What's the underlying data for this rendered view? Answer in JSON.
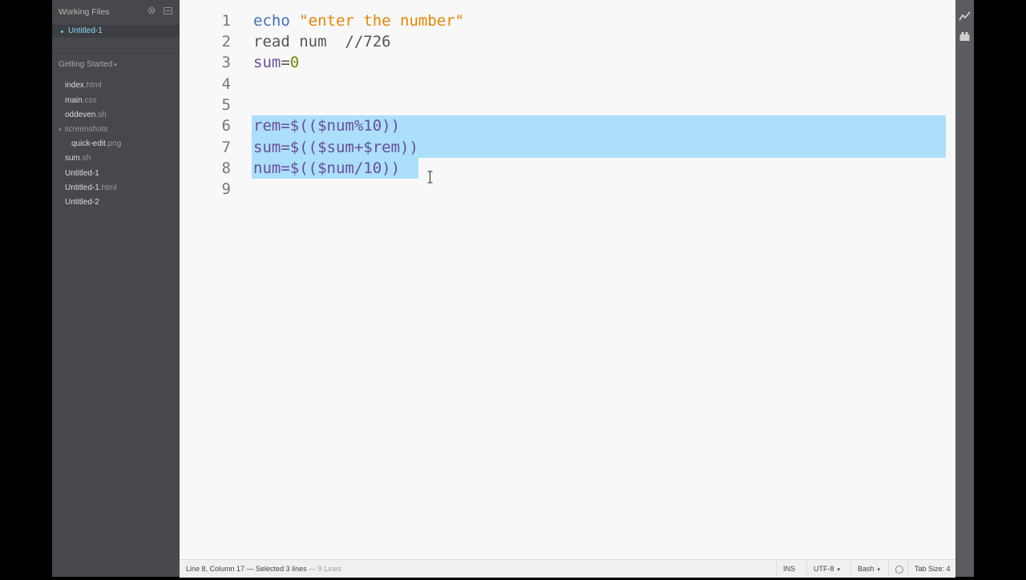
{
  "sidebar": {
    "working_files_label": "Working Files",
    "active_file": "Untitled-1",
    "project_label": "Getting Started",
    "tree": [
      {
        "name": "index",
        "ext": ".html"
      },
      {
        "name": "main",
        "ext": ".css"
      },
      {
        "name": "oddeven",
        "ext": ".sh"
      },
      {
        "name": "screenshots",
        "ext": "",
        "folder": true
      },
      {
        "name": "quick-edit",
        "ext": ".png"
      },
      {
        "name": "sum",
        "ext": ".sh"
      },
      {
        "name": "Untitled-1",
        "ext": ""
      },
      {
        "name": "Untitled-1",
        "ext": ".html"
      },
      {
        "name": "Untitled-2",
        "ext": ""
      }
    ]
  },
  "editor": {
    "line_numbers": [
      "1",
      "2",
      "3",
      "4",
      "5",
      "6",
      "7",
      "8",
      "9"
    ],
    "lines": {
      "l1_kw": "echo",
      "l1_str": "\"enter the number\"",
      "l2": "read num  //726",
      "l3_var": "sum",
      "l3_eq": "=",
      "l3_num": "0",
      "l6": "rem=$(($num%10))",
      "l7": "sum=$(($sum+$rem))",
      "l8": "num=$(($num/10))"
    }
  },
  "statusbar": {
    "cursor_info": "Line 8, Column 17 — Selected 3 lines",
    "line_count": "— 9 Lines",
    "mode": "INS",
    "encoding": "UTF-8",
    "language": "Bash",
    "tab_size": "Tab Size: 4"
  },
  "colors": {
    "selection": "#abdffa",
    "keyword": "#446fbd",
    "string": "#e88501",
    "number": "#6d8600",
    "variable": "#6a4e99"
  }
}
